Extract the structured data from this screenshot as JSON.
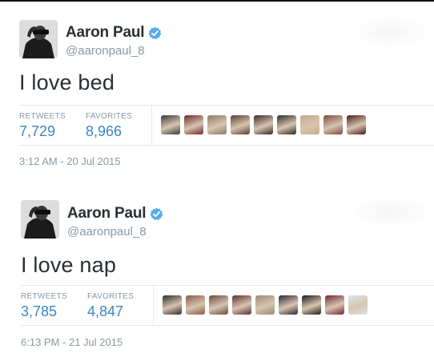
{
  "tweets": [
    {
      "name": "Aaron Paul",
      "handle": "@aaronpaul_8",
      "text": "I love bed",
      "retweets_label": "RETWEETS",
      "retweets": "7,729",
      "favorites_label": "FAVORITES",
      "favorites": "8,966",
      "timestamp": "3:12 AM - 20 Jul 2015",
      "faces": [
        "#3a3a3a",
        "#6b2a2a",
        "#8a7a6a",
        "#5a3a3a",
        "#3a2a2a",
        "#2a2a2a",
        "#c9a98a",
        "#7a4a3a",
        "#4a1a1a"
      ]
    },
    {
      "name": "Aaron Paul",
      "handle": "@aaronpaul_8",
      "text": "I love nap",
      "retweets_label": "RETWEETS",
      "retweets": "3,785",
      "favorites_label": "FAVORITES",
      "favorites": "4,847",
      "timestamp": "6:13 PM - 21 Jul 2015",
      "faces": [
        "#2a2a2a",
        "#8a5a4a",
        "#6a4a3a",
        "#5a3030",
        "#9a8a7a",
        "#2a2a3a",
        "#1a1a1a",
        "#6a2a3a",
        "#d9e4ec"
      ]
    }
  ],
  "colors": {
    "link": "#3b88c3",
    "muted": "#8899a6",
    "text": "#292f33",
    "verified": "#55acee"
  },
  "icons": {
    "verified": "verified-badge-icon"
  }
}
